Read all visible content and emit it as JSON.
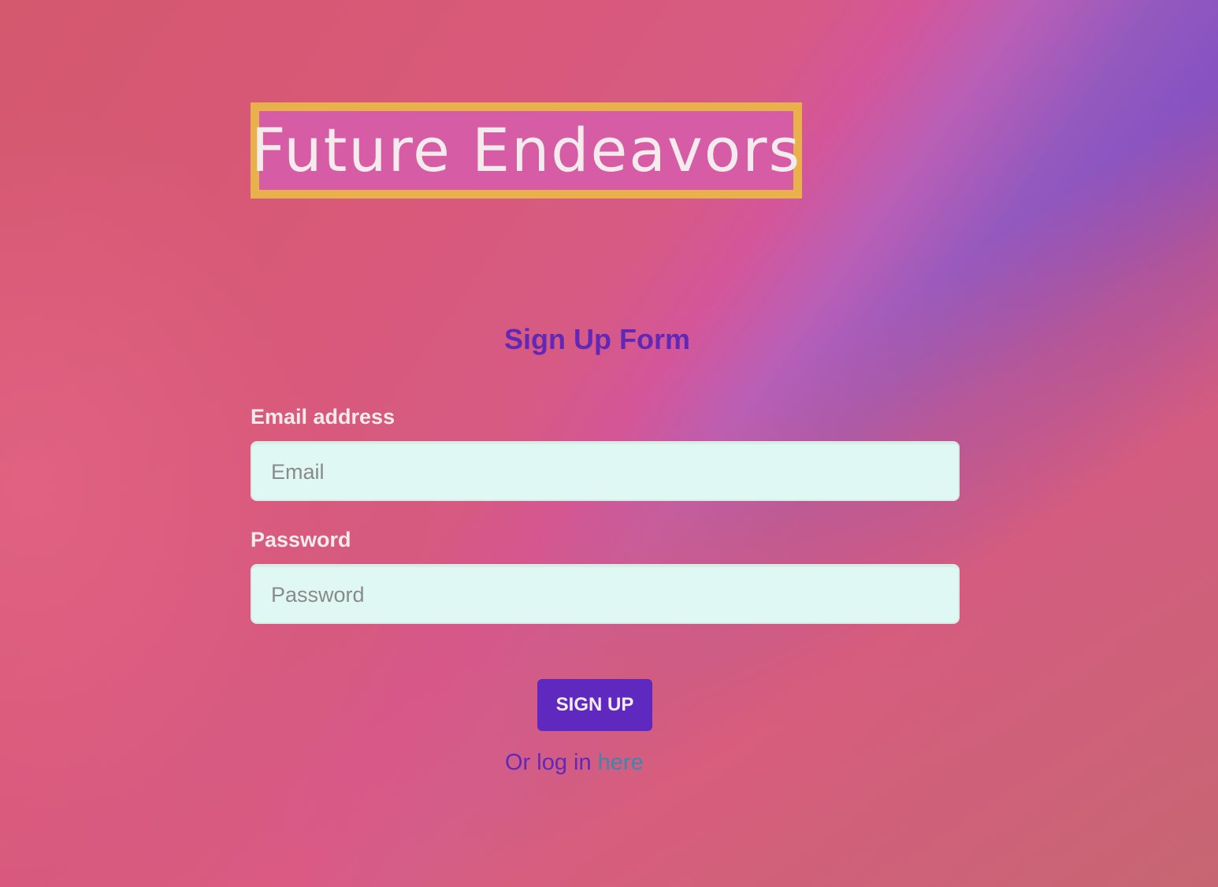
{
  "brand": {
    "logo_text": "Future Endeavors"
  },
  "form": {
    "title": "Sign Up Form",
    "email": {
      "label": "Email address",
      "placeholder": "Email",
      "value": ""
    },
    "password": {
      "label": "Password",
      "placeholder": "Password",
      "value": ""
    },
    "submit_label": "SIGN UP",
    "login_prompt": "Or log in ",
    "login_link_label": "here"
  },
  "colors": {
    "accent": "#5f29c0",
    "title": "#6128b8",
    "link": "#3f86a8",
    "input_bg": "#dff8f3",
    "logo_border": "#e9b14c",
    "logo_fill": "#d75ca6"
  }
}
